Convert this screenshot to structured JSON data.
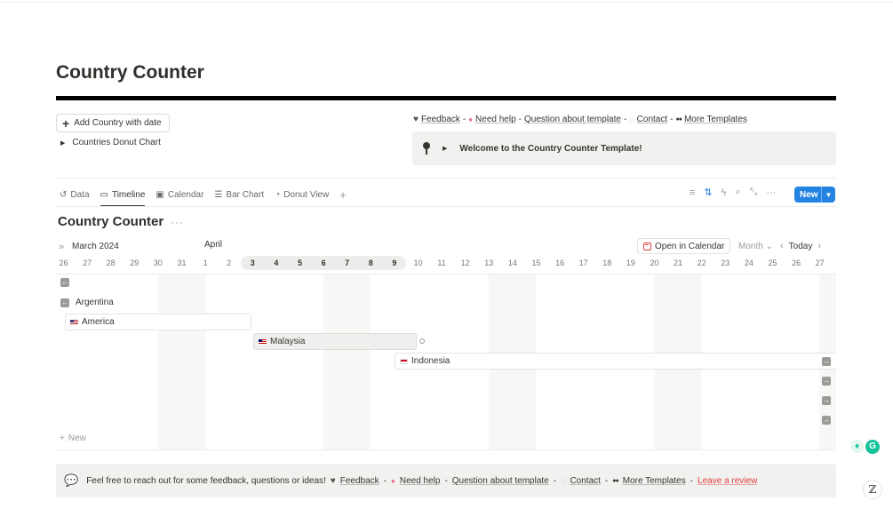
{
  "page": {
    "title": "Country Counter"
  },
  "actions": {
    "add_button": "Add Country with date",
    "toggle_label": "Countries Donut Chart"
  },
  "links": {
    "feedback": "Feedback",
    "need_help": "Need help",
    "question": "Question about template",
    "contact": "Contact",
    "more_templates": "More Templates",
    "leave_review": "Leave a review",
    "sep": "-"
  },
  "callout": {
    "text": "Welcome to the Country Counter Template!"
  },
  "tabs": [
    {
      "label": "Data",
      "icon": "clock-rewind-icon"
    },
    {
      "label": "Timeline",
      "icon": "timeline-icon",
      "active": true
    },
    {
      "label": "Calendar",
      "icon": "calendar-icon"
    },
    {
      "label": "Bar Chart",
      "icon": "bar-chart-icon"
    },
    {
      "label": "Donut View",
      "icon": "donut-icon"
    }
  ],
  "toolbar": {
    "new_label": "New",
    "icons": [
      "filter-icon",
      "sort-icon",
      "automation-icon",
      "search-icon",
      "expand-icon",
      "more-icon"
    ]
  },
  "database": {
    "title": "Country Counter"
  },
  "timeline": {
    "month_1": "March 2024",
    "month_2": "April",
    "open_calendar": "Open in Calendar",
    "scale": "Month",
    "today": "Today",
    "days": [
      "26",
      "27",
      "28",
      "29",
      "30",
      "31",
      "1",
      "2",
      "3",
      "4",
      "5",
      "6",
      "7",
      "8",
      "9",
      "10",
      "11",
      "12",
      "13",
      "14",
      "15",
      "16",
      "17",
      "18",
      "19",
      "20",
      "21",
      "22",
      "23",
      "24",
      "25",
      "26",
      "27"
    ],
    "highlighted_days": [
      "3",
      "4",
      "5",
      "6",
      "7",
      "8",
      "9"
    ],
    "rows": [
      {
        "label": "Argentina",
        "flag": "argentina-flag"
      },
      {
        "label": "America",
        "flag": "us-flag"
      },
      {
        "label": "Malaysia",
        "flag": "malaysia-flag"
      },
      {
        "label": "Indonesia",
        "flag": "indonesia-flag"
      }
    ],
    "new_label": "New"
  },
  "footer": {
    "text": "Feel free to reach out for some feedback, questions or ideas!"
  },
  "colors": {
    "accent": "#2383e2",
    "review": "#e03e3e",
    "callout_bg": "#f1f1ef"
  }
}
